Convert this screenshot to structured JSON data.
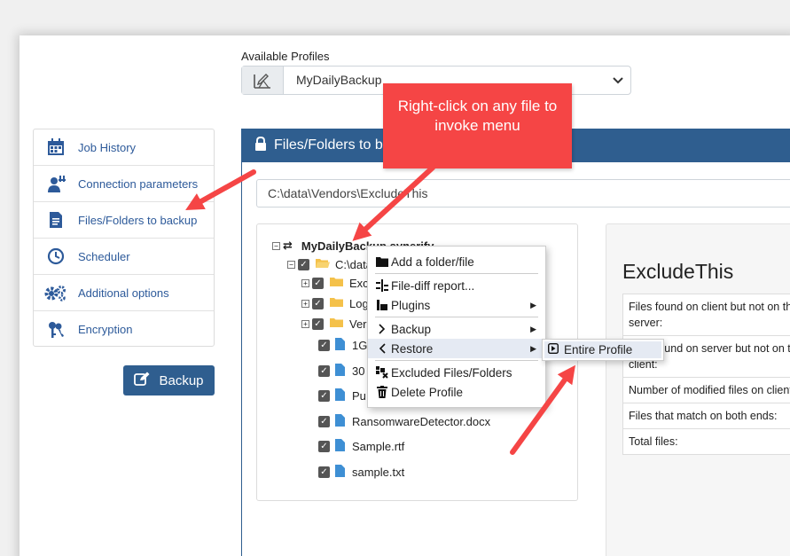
{
  "profiles": {
    "label": "Available Profiles",
    "selected": "MyDailyBackup"
  },
  "nav": {
    "items": [
      {
        "label": "Job History",
        "icon": "calendar-icon"
      },
      {
        "label": "Connection parameters",
        "icon": "user-connection-icon"
      },
      {
        "label": "Files/Folders to backup",
        "icon": "document-icon"
      },
      {
        "label": "Scheduler",
        "icon": "clock-icon"
      },
      {
        "label": "Additional options",
        "icon": "gears-icon"
      },
      {
        "label": "Encryption",
        "icon": "keys-icon"
      }
    ]
  },
  "backup_button": {
    "label": "Backup"
  },
  "panel": {
    "title": "Files/Folders to ba",
    "path": "C:\\data\\Vendors\\ExcludeThis"
  },
  "tree": {
    "root": "MyDailyBackup.synerify",
    "folder_root": "C:\\data",
    "folders": [
      "Exc",
      "Log",
      "Vers"
    ],
    "files": [
      "1G",
      "30",
      "Pu",
      "RansomwareDetector.docx",
      "Sample.rtf",
      "sample.txt"
    ]
  },
  "context_menu": {
    "add": "Add a folder/file",
    "file_diff": "File-diff report...",
    "plugins": "Plugins",
    "backup": "Backup",
    "restore": "Restore",
    "excluded": "Excluded Files/Folders",
    "delete": "Delete Profile"
  },
  "submenu": {
    "entire_profile": "Entire Profile"
  },
  "info": {
    "title": "ExcludeThis",
    "rows": [
      "Files found on client but not on the server:",
      "Files found on server but not on the client:",
      "Number of modified files on client:",
      "Files that match on both ends:",
      "Total files:"
    ]
  },
  "callout": {
    "text": "Right-click on any file to invoke menu"
  },
  "colors": {
    "primary": "#2f5e8f",
    "callout": "#f54545",
    "link": "#2d5a9a"
  }
}
